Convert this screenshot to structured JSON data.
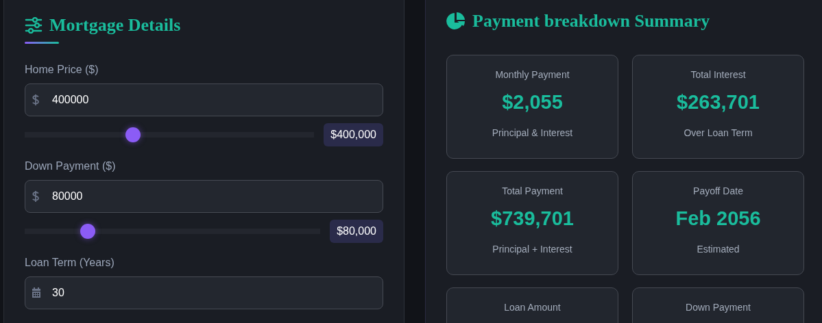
{
  "mortgage_details": {
    "title": "Mortgage Details",
    "fields": [
      {
        "kind": "slider",
        "label": "Home Price ($)",
        "value": "400000",
        "level": 0.375,
        "badge": "$400,000"
      },
      {
        "kind": "slider",
        "label": "Down Payment ($)",
        "value": "80000",
        "level": 0.213,
        "badge": "$80,000"
      },
      {
        "kind": "plain",
        "label": "Loan Term (Years)",
        "value": "30"
      }
    ]
  },
  "summary": {
    "title": "Payment breakdown Summary",
    "cards": [
      {
        "label": "Monthly Payment",
        "value": "$2,055",
        "note": "Principal & Interest"
      },
      {
        "label": "Total Interest",
        "value": "$263,701",
        "note": "Over Loan Term"
      },
      {
        "label": "Total Payment",
        "value": "$739,701",
        "note": "Principal + Interest"
      },
      {
        "label": "Payoff Date",
        "value": "Feb 2056",
        "note": "Estimated"
      },
      {
        "label": "Loan Amount"
      },
      {
        "label": "Down Payment"
      }
    ]
  }
}
